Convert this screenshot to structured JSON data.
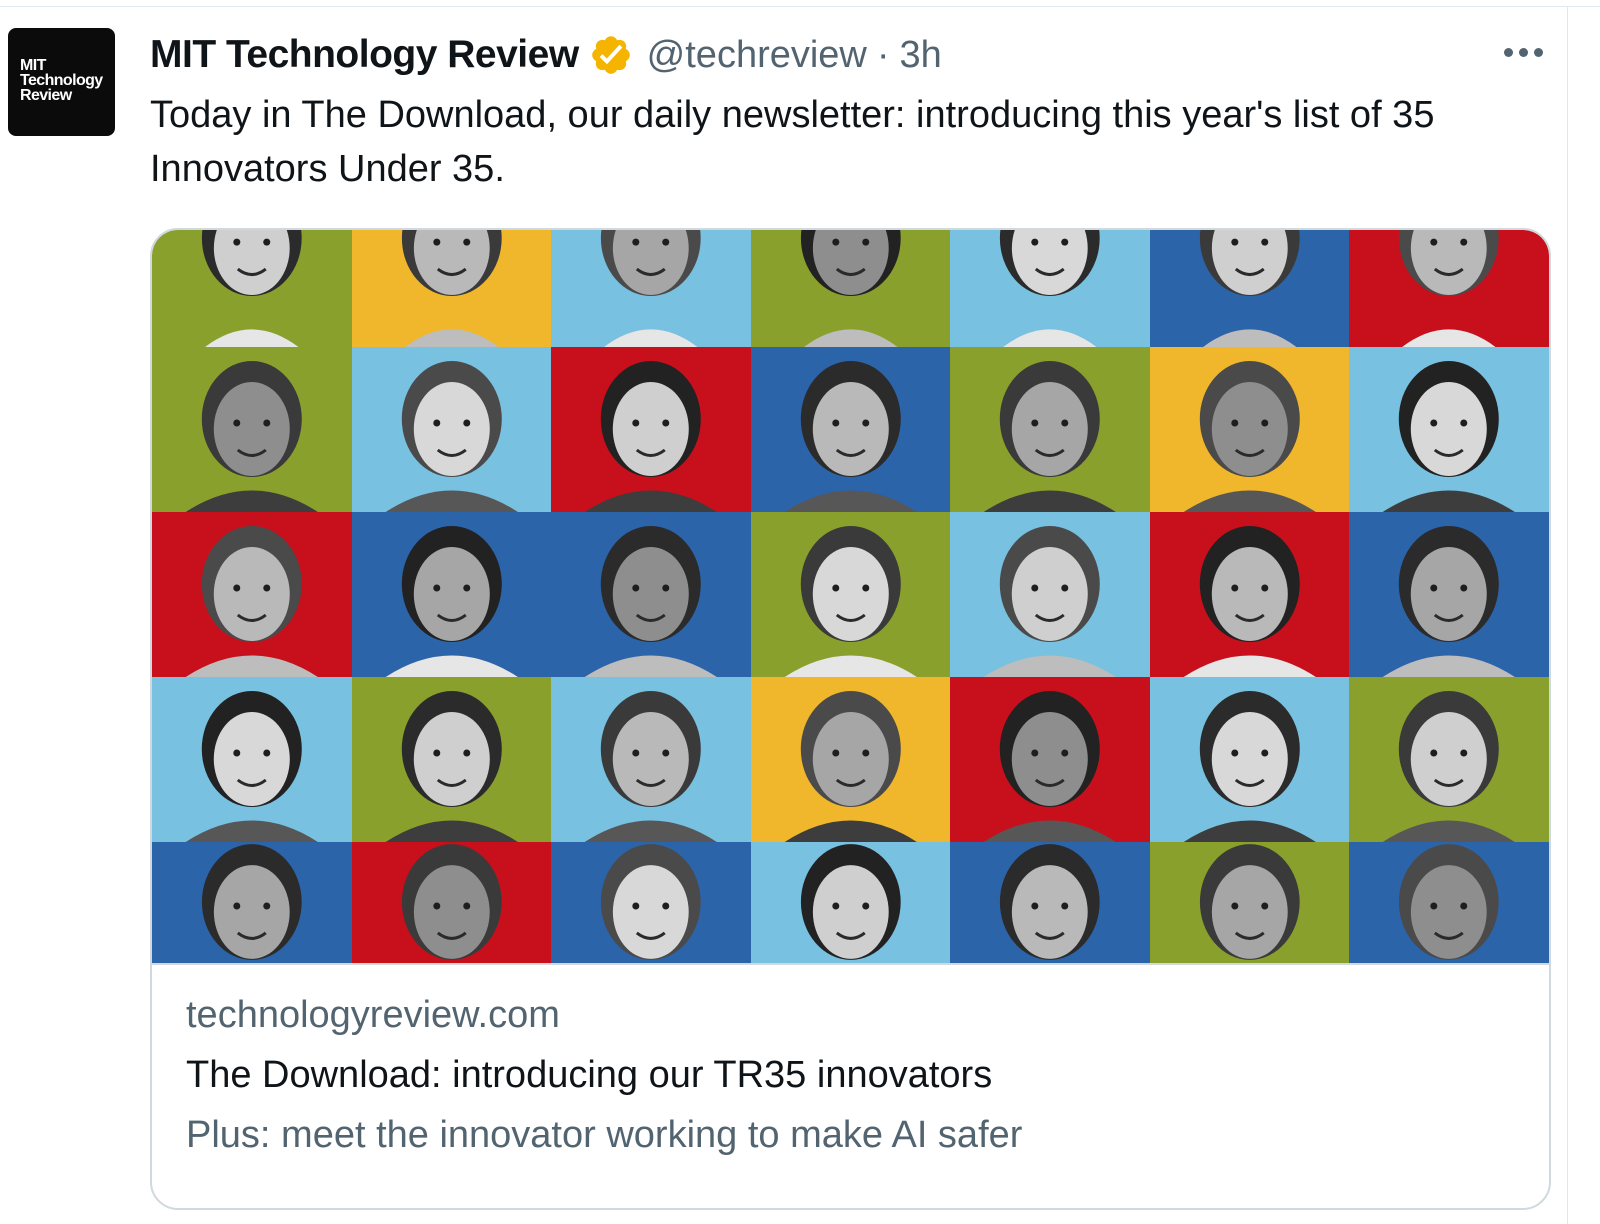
{
  "tweet": {
    "avatar_lines": [
      "MIT",
      "Technology",
      "Review"
    ],
    "author_name": "MIT Technology Review",
    "handle": "@techreview",
    "separator": "·",
    "time": "3h",
    "text": "Today in The Download, our daily newsletter: introducing this year's list of 35 Innovators Under 35."
  },
  "card": {
    "domain": "technologyreview.com",
    "title": "The Download: introducing our TR35 innovators",
    "description": "Plus: meet the innovator working to make AI safer"
  },
  "mosaic": {
    "palette": {
      "green": "#8aa02c",
      "yellow": "#f0b62c",
      "lightblue": "#78c1e0",
      "red": "#c7101c",
      "blue": "#2c64aa"
    },
    "rows": [
      [
        "green",
        "yellow",
        "lightblue",
        "green",
        "lightblue",
        "blue",
        "red"
      ],
      [
        "green",
        "lightblue",
        "red",
        "blue",
        "green",
        "yellow",
        "lightblue"
      ],
      [
        "red",
        "blue",
        "blue",
        "green",
        "lightblue",
        "red",
        "blue"
      ],
      [
        "lightblue",
        "green",
        "lightblue",
        "yellow",
        "red",
        "lightblue",
        "green"
      ],
      [
        "blue",
        "red",
        "blue",
        "lightblue",
        "blue",
        "green",
        "blue"
      ]
    ]
  },
  "icons": {
    "verified": "verified-badge-icon",
    "more": "more-options-icon"
  },
  "colors": {
    "verified_badge": "#f4b400",
    "secondary_text": "#536471",
    "border": "#cfd9de"
  }
}
